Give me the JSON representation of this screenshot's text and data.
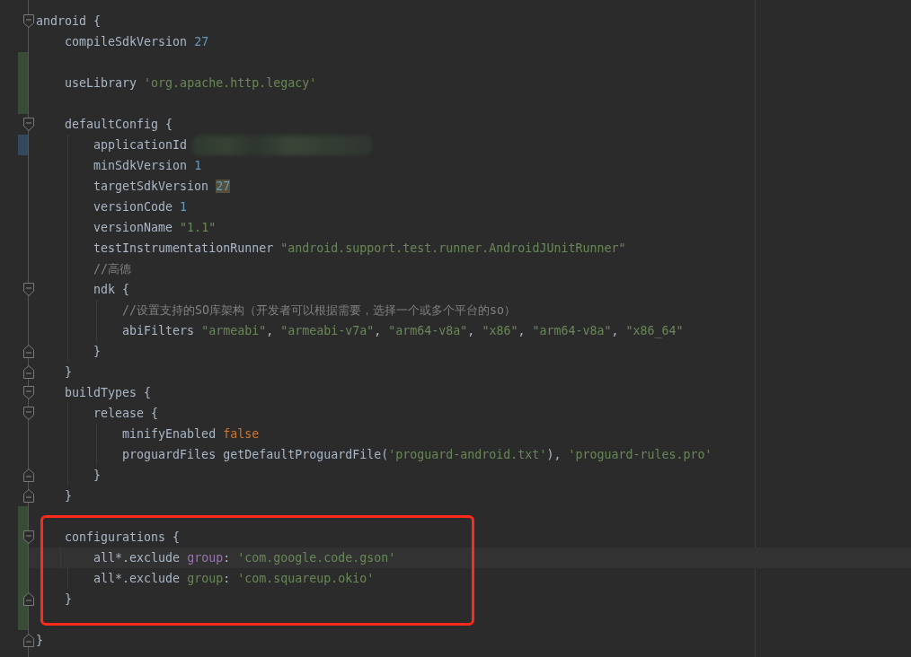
{
  "editor": {
    "lines": [
      {
        "current": false,
        "added": false,
        "modified": false,
        "fold_start": true,
        "fold_end": false,
        "tokens": [
          {
            "kind": "plain",
            "text": "android {"
          }
        ]
      },
      {
        "current": false,
        "added": false,
        "modified": false,
        "fold_start": false,
        "fold_end": false,
        "tokens": [
          {
            "kind": "plain",
            "text": "    compileSdkVersion "
          },
          {
            "kind": "number",
            "text": "27"
          }
        ]
      },
      {
        "current": false,
        "added": true,
        "modified": false,
        "fold_start": false,
        "fold_end": false
      },
      {
        "current": false,
        "added": true,
        "modified": false,
        "fold_start": false,
        "fold_end": false,
        "tokens": [
          {
            "kind": "plain",
            "text": "    useLibrary "
          },
          {
            "kind": "string",
            "text": "'org.apache.http.legacy'"
          }
        ]
      },
      {
        "current": false,
        "added": true,
        "modified": false,
        "fold_start": false,
        "fold_end": false
      },
      {
        "current": false,
        "added": false,
        "modified": false,
        "fold_start": true,
        "fold_end": false,
        "tokens": [
          {
            "kind": "plain",
            "text": "    defaultConfig {"
          }
        ]
      },
      {
        "current": false,
        "added": false,
        "modified": true,
        "fold_start": false,
        "fold_end": false,
        "redacted": true,
        "tokens": [
          {
            "kind": "plain",
            "text": "        applicationId"
          }
        ]
      },
      {
        "current": false,
        "added": false,
        "modified": false,
        "fold_start": false,
        "fold_end": false,
        "tokens": [
          {
            "kind": "plain",
            "text": "        minSdkVersion "
          },
          {
            "kind": "number",
            "text": "1"
          }
        ]
      },
      {
        "current": false,
        "added": false,
        "modified": false,
        "fold_start": false,
        "fold_end": false,
        "tokens": [
          {
            "kind": "plain",
            "text": "        targetSdkVersion "
          },
          {
            "kind": "number",
            "text": "27",
            "highlighted": true
          }
        ]
      },
      {
        "current": false,
        "added": false,
        "modified": false,
        "fold_start": false,
        "fold_end": false,
        "tokens": [
          {
            "kind": "plain",
            "text": "        versionCode "
          },
          {
            "kind": "number",
            "text": "1"
          }
        ]
      },
      {
        "current": false,
        "added": false,
        "modified": false,
        "fold_start": false,
        "fold_end": false,
        "tokens": [
          {
            "kind": "plain",
            "text": "        versionName "
          },
          {
            "kind": "string",
            "text": "\"1.1\""
          }
        ]
      },
      {
        "current": false,
        "added": false,
        "modified": false,
        "fold_start": false,
        "fold_end": false,
        "tokens": [
          {
            "kind": "plain",
            "text": "        testInstrumentationRunner "
          },
          {
            "kind": "string",
            "text": "\"android.support.test.runner.AndroidJUnitRunner\""
          }
        ]
      },
      {
        "current": false,
        "added": false,
        "modified": false,
        "fold_start": false,
        "fold_end": false,
        "tokens": [
          {
            "kind": "comment",
            "text": "        //高德"
          }
        ]
      },
      {
        "current": false,
        "added": false,
        "modified": false,
        "fold_start": true,
        "fold_end": false,
        "tokens": [
          {
            "kind": "plain",
            "text": "        ndk {"
          }
        ]
      },
      {
        "current": false,
        "added": false,
        "modified": false,
        "fold_start": false,
        "fold_end": false,
        "tokens": [
          {
            "kind": "comment",
            "text": "            //设置支持的SO库架构（开发者可以根据需要，选择一个或多个平台的so）"
          }
        ]
      },
      {
        "current": false,
        "added": false,
        "modified": false,
        "fold_start": false,
        "fold_end": false,
        "tokens": [
          {
            "kind": "plain",
            "text": "            abiFilters "
          },
          {
            "kind": "string",
            "text": "\"armeabi\""
          },
          {
            "kind": "plain",
            "text": ", "
          },
          {
            "kind": "string",
            "text": "\"armeabi-v7a\""
          },
          {
            "kind": "plain",
            "text": ", "
          },
          {
            "kind": "string",
            "text": "\"arm64-v8a\""
          },
          {
            "kind": "plain",
            "text": ", "
          },
          {
            "kind": "string",
            "text": "\"x86\""
          },
          {
            "kind": "plain",
            "text": ", "
          },
          {
            "kind": "string",
            "text": "\"arm64-v8a\""
          },
          {
            "kind": "plain",
            "text": ", "
          },
          {
            "kind": "string",
            "text": "\"x86_64\""
          }
        ]
      },
      {
        "current": false,
        "added": false,
        "modified": false,
        "fold_start": false,
        "fold_end": true,
        "tokens": [
          {
            "kind": "plain",
            "text": "        }"
          }
        ]
      },
      {
        "current": false,
        "added": false,
        "modified": false,
        "fold_start": false,
        "fold_end": true,
        "tokens": [
          {
            "kind": "plain",
            "text": "    }"
          }
        ]
      },
      {
        "current": false,
        "added": false,
        "modified": false,
        "fold_start": true,
        "fold_end": false,
        "tokens": [
          {
            "kind": "plain",
            "text": "    buildTypes {"
          }
        ]
      },
      {
        "current": false,
        "added": false,
        "modified": false,
        "fold_start": true,
        "fold_end": false,
        "tokens": [
          {
            "kind": "plain",
            "text": "        release {"
          }
        ]
      },
      {
        "current": false,
        "added": false,
        "modified": false,
        "fold_start": false,
        "fold_end": false,
        "tokens": [
          {
            "kind": "plain",
            "text": "            minifyEnabled "
          },
          {
            "kind": "keyword",
            "text": "false"
          }
        ]
      },
      {
        "current": false,
        "added": false,
        "modified": false,
        "fold_start": false,
        "fold_end": false,
        "tokens": [
          {
            "kind": "plain",
            "text": "            proguardFiles getDefaultProguardFile("
          },
          {
            "kind": "string",
            "text": "'proguard-android.txt'"
          },
          {
            "kind": "plain",
            "text": "), "
          },
          {
            "kind": "string",
            "text": "'proguard-rules.pro'"
          }
        ]
      },
      {
        "current": false,
        "added": false,
        "modified": false,
        "fold_start": false,
        "fold_end": true,
        "tokens": [
          {
            "kind": "plain",
            "text": "        }"
          }
        ]
      },
      {
        "current": false,
        "added": false,
        "modified": false,
        "fold_start": false,
        "fold_end": true,
        "tokens": [
          {
            "kind": "plain",
            "text": "    }"
          }
        ]
      },
      {
        "current": false,
        "added": true,
        "modified": false,
        "fold_start": false,
        "fold_end": false
      },
      {
        "current": false,
        "added": true,
        "modified": false,
        "fold_start": true,
        "fold_end": false,
        "tokens": [
          {
            "kind": "plain",
            "text": "    configurations {"
          }
        ]
      },
      {
        "current": true,
        "added": true,
        "modified": false,
        "fold_start": false,
        "fold_end": false,
        "tokens": [
          {
            "kind": "plain",
            "text": "        all*.exclude "
          },
          {
            "kind": "param",
            "text": "group"
          },
          {
            "kind": "plain",
            "text": ": "
          },
          {
            "kind": "string",
            "text": "'com.google.code.gson'"
          }
        ]
      },
      {
        "current": false,
        "added": true,
        "modified": false,
        "fold_start": false,
        "fold_end": false,
        "tokens": [
          {
            "kind": "plain",
            "text": "        all*.exclude "
          },
          {
            "kind": "string",
            "text": "group"
          },
          {
            "kind": "plain",
            "text": ": "
          },
          {
            "kind": "string",
            "text": "'com.squareup.okio'"
          }
        ]
      },
      {
        "current": false,
        "added": true,
        "modified": false,
        "fold_start": false,
        "fold_end": true,
        "tokens": [
          {
            "kind": "plain",
            "text": "    }"
          }
        ]
      },
      {
        "current": false,
        "added": true,
        "modified": false,
        "fold_start": false,
        "fold_end": false
      },
      {
        "current": false,
        "added": false,
        "modified": false,
        "fold_start": false,
        "fold_end": true,
        "tokens": [
          {
            "kind": "plain",
            "text": "}"
          }
        ]
      }
    ]
  }
}
